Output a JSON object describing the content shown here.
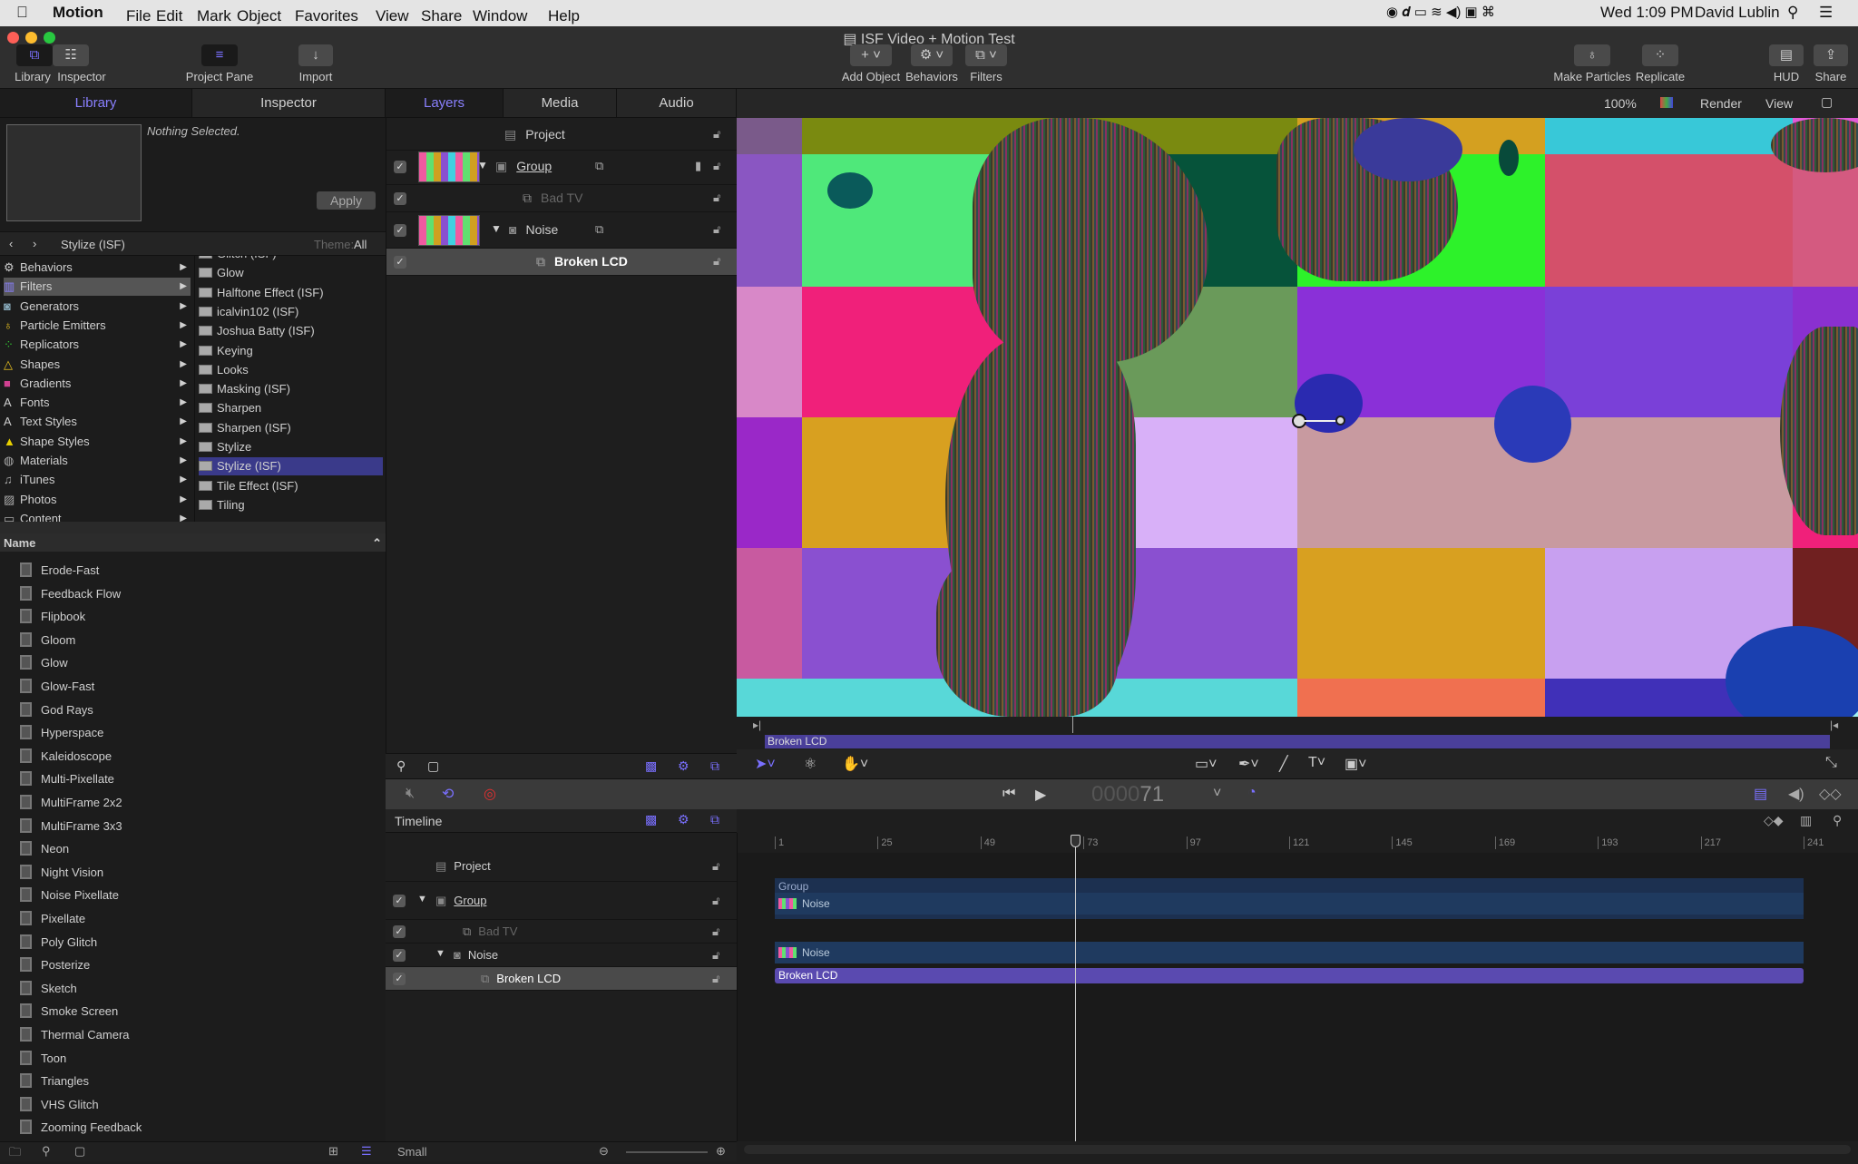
{
  "menubar": {
    "app": "Motion",
    "items": [
      "File",
      "Edit",
      "Mark",
      "Object",
      "Favorites",
      "View",
      "Share",
      "Window",
      "Help"
    ],
    "clock": "Wed 1:09 PM",
    "user": "David Lublin"
  },
  "window": {
    "title": "ISF Video + Motion Test"
  },
  "toolbar": {
    "library": "Library",
    "inspector": "Inspector",
    "project_pane": "Project Pane",
    "import": "Import",
    "add_object": "Add Object",
    "behaviors": "Behaviors",
    "filters": "Filters",
    "make_particles": "Make Particles",
    "replicate": "Replicate",
    "hud": "HUD",
    "share": "Share"
  },
  "left_tabs": {
    "library": "Library",
    "inspector": "Inspector"
  },
  "library": {
    "preview_text": "Nothing Selected.",
    "apply": "Apply",
    "path": "Stylize (ISF)",
    "theme_label": "Theme:",
    "theme_value": "All",
    "categories": [
      "Behaviors",
      "Filters",
      "Generators",
      "Particle Emitters",
      "Replicators",
      "Shapes",
      "Gradients",
      "Fonts",
      "Text Styles",
      "Shape Styles",
      "Materials",
      "iTunes",
      "Photos",
      "Content"
    ],
    "selected_category": "Filters",
    "subfolders": [
      "Glitch (ISF)",
      "Glow",
      "Halftone Effect (ISF)",
      "icalvin102 (ISF)",
      "Joshua Batty (ISF)",
      "Keying",
      "Looks",
      "Masking (ISF)",
      "Sharpen",
      "Sharpen (ISF)",
      "Stylize",
      "Stylize (ISF)",
      "Tile Effect (ISF)",
      "Tiling"
    ],
    "selected_subfolder": "Stylize (ISF)",
    "name_header": "Name",
    "items": [
      "Erode-Fast",
      "Feedback Flow",
      "Flipbook",
      "Gloom",
      "Glow",
      "Glow-Fast",
      "God Rays",
      "Hyperspace",
      "Kaleidoscope",
      "Multi-Pixellate",
      "MultiFrame 2x2",
      "MultiFrame 3x3",
      "Neon",
      "Night Vision",
      "Noise Pixellate",
      "Pixellate",
      "Poly Glitch",
      "Posterize",
      "Sketch",
      "Smoke Screen",
      "Thermal Camera",
      "Toon",
      "Triangles",
      "VHS Glitch",
      "Zooming Feedback"
    ]
  },
  "mid_tabs": {
    "layers": "Layers",
    "media": "Media",
    "audio": "Audio"
  },
  "layers": [
    {
      "name": "Project",
      "type": "project"
    },
    {
      "name": "Group",
      "type": "group",
      "checked": true
    },
    {
      "name": "Bad TV",
      "type": "filter",
      "checked": true,
      "disabled": true
    },
    {
      "name": "Noise",
      "type": "generator",
      "checked": true
    },
    {
      "name": "Broken LCD",
      "type": "filter",
      "checked": true,
      "selected": true
    }
  ],
  "canvas": {
    "zoom": "100%",
    "render": "Render",
    "view": "View",
    "clip_label": "Broken LCD"
  },
  "transport": {
    "timecode_dim": "0000",
    "timecode": "71"
  },
  "timeline": {
    "title": "Timeline",
    "size": "Small",
    "ticks": [
      "1",
      "25",
      "49",
      "73",
      "97",
      "121",
      "145",
      "169",
      "193",
      "217",
      "241"
    ],
    "playhead_frame": 71,
    "start": 1,
    "end": 241,
    "tracks": {
      "group": "Group",
      "noise1": "Noise",
      "noise2": "Noise",
      "broken": "Broken LCD"
    }
  },
  "colors": {
    "accent": "#7a70ff",
    "clip": "#4a3f9a",
    "track": "#1f3a5f",
    "selection": "#3a3a8a"
  }
}
